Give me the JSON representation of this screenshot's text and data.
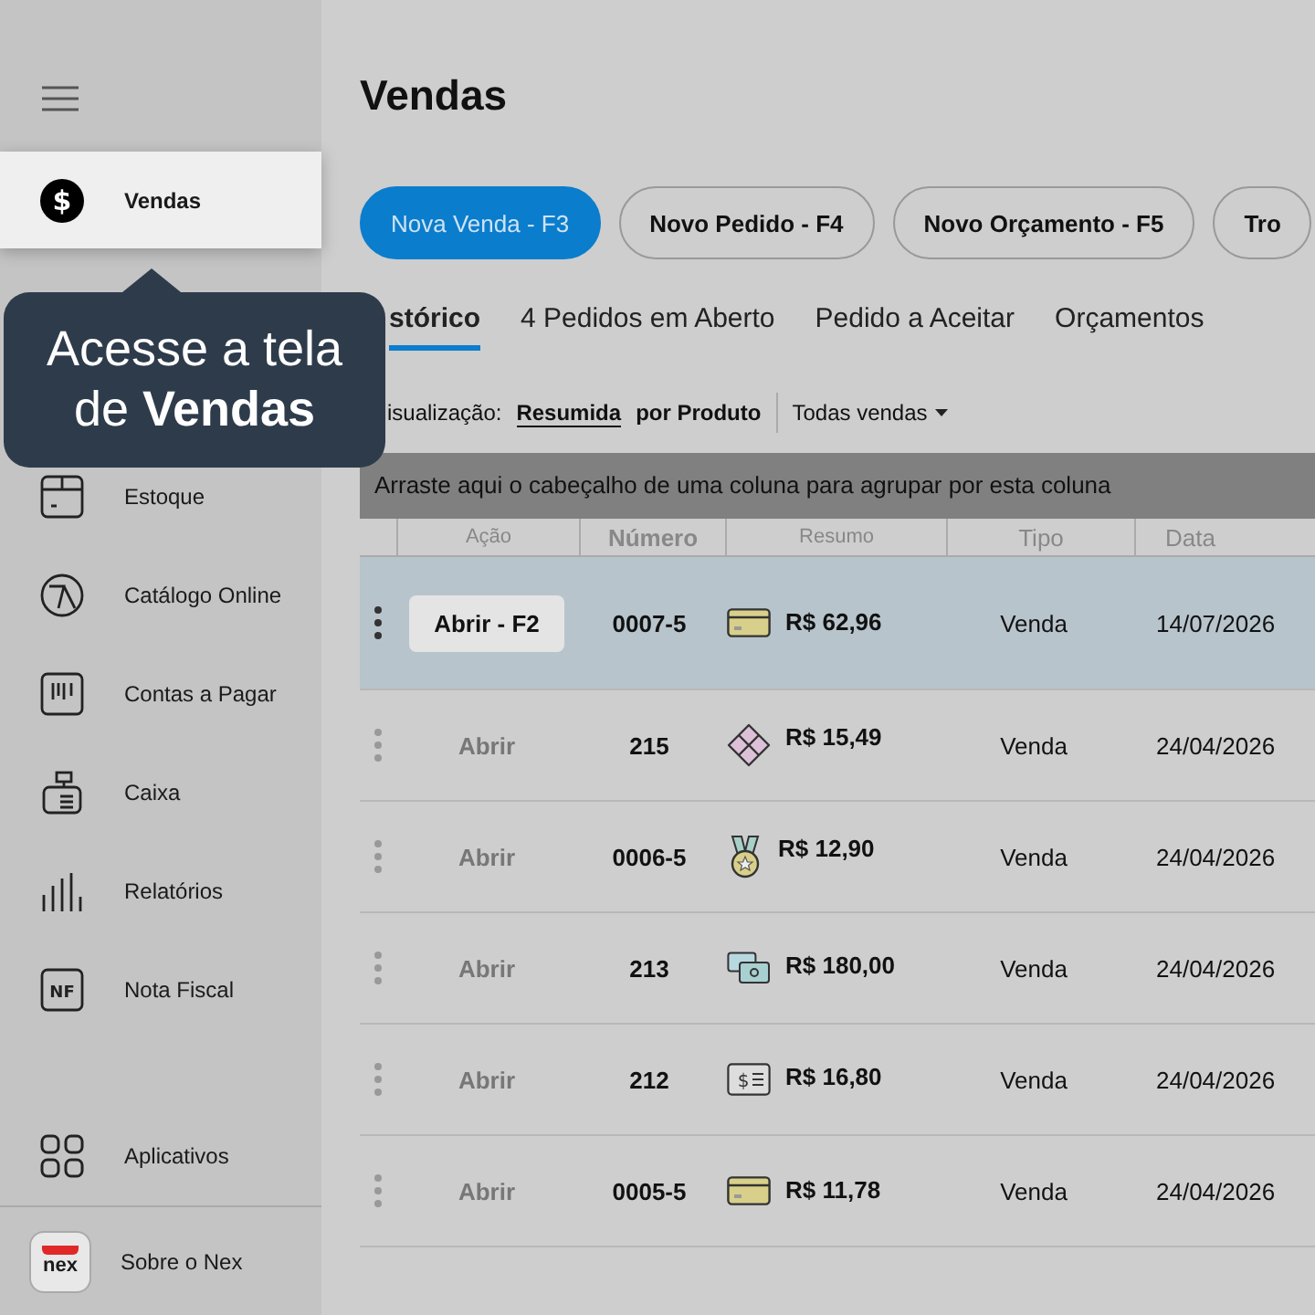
{
  "sidebar": {
    "items": [
      {
        "label": "Vendas",
        "selected": true,
        "icon_glyph": "$"
      },
      {
        "label": "Estoque",
        "selected": false
      },
      {
        "label": "Catálogo Online",
        "selected": false
      },
      {
        "label": "Contas a Pagar",
        "selected": false
      },
      {
        "label": "Caixa",
        "selected": false
      },
      {
        "label": "Relatórios",
        "selected": false
      },
      {
        "label": "Nota Fiscal",
        "selected": false,
        "icon_glyph": "NF"
      }
    ],
    "apps": {
      "label": "Aplicativos"
    },
    "about": {
      "logo": "nex",
      "label": "Sobre o Nex"
    }
  },
  "tooltip": {
    "text": "Acesse a tela de **Vendas**"
  },
  "title": "Vendas",
  "actions": [
    {
      "label": "Nova Venda - F3",
      "primary": true
    },
    {
      "label": "Novo Pedido - F4",
      "primary": false
    },
    {
      "label": "Novo Orçamento - F5",
      "primary": false
    },
    {
      "label": "Tro",
      "primary": false
    }
  ],
  "tabs": [
    {
      "label": "stórico",
      "selected": true
    },
    {
      "label": "4 Pedidos em Aberto",
      "selected": false
    },
    {
      "label": "Pedido a Aceitar",
      "selected": false
    },
    {
      "label": "Orçamentos",
      "selected": false
    }
  ],
  "view": {
    "label": "isualização:",
    "options": [
      {
        "label": "Resumida",
        "selected": true
      },
      {
        "label": "por Produto",
        "selected": false
      }
    ],
    "filter": "Todas vendas"
  },
  "table": {
    "group_hint": "Arraste aqui o cabeçalho de uma coluna para agrupar por esta coluna",
    "columns": [
      "Ação",
      "Número",
      "Resumo",
      "Tipo",
      "Data"
    ],
    "rows": [
      {
        "selected": true,
        "action": "Abrir - F2",
        "number": "0007-5",
        "kind": "card",
        "total": "R$ 62,96",
        "type": "Venda",
        "date": "14/07/2026"
      },
      {
        "selected": false,
        "action": "Abrir",
        "number": "215",
        "kind": "pix",
        "total": "R$ 15,49",
        "type": "Venda",
        "date": "24/04/2026"
      },
      {
        "selected": false,
        "action": "Abrir",
        "number": "0006-5",
        "kind": "voucher",
        "total": "R$ 12,90",
        "type": "Venda",
        "date": "24/04/2026"
      },
      {
        "selected": false,
        "action": "Abrir",
        "number": "213",
        "kind": "cash",
        "total": "R$ 180,00",
        "type": "Venda",
        "date": "24/04/2026"
      },
      {
        "selected": false,
        "action": "Abrir",
        "number": "212",
        "kind": "bill",
        "icon_glyph": "$",
        "total": "R$ 16,80",
        "type": "Venda",
        "date": "24/04/2026"
      },
      {
        "selected": false,
        "action": "Abrir",
        "number": "0005-5",
        "kind": "card",
        "total": "R$ 11,78",
        "type": "Venda",
        "date": "24/04/2026"
      }
    ]
  }
}
